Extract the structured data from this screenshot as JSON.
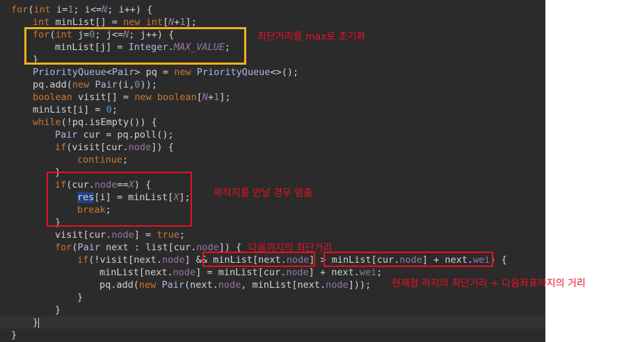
{
  "editor": {
    "lines": [
      "for(int i=1; i<=N; i++) {",
      "int minList[] = new int[N+1];",
      "for(int j=0; j<=N; j++) {",
      "minList[j] = Integer.MAX_VALUE;",
      "}",
      "PriorityQueue<Pair> pq = new PriorityQueue<>();",
      "pq.add(new Pair(i,0));",
      "boolean visit[] = new boolean[N+1];",
      "minList[i] = 0;",
      "while(!pq.isEmpty()) {",
      "Pair cur = pq.poll();",
      "if(visit[cur.node]) {",
      "continue;",
      "}",
      "if(cur.node==X) {",
      "res[i] = minList[X];",
      "break;",
      "}",
      "visit[cur.node] = true;",
      "for(Pair next : list[cur.node]) {",
      "if(!visit[next.node] && minList[next.node] > minList[cur.node] + next.wei) {",
      "minList[next.node] = minList[cur.node] + next.wei;",
      "pq.add(new Pair(next.node, minList[next.node]));",
      "}",
      "}",
      "}",
      "}"
    ]
  },
  "annotations": {
    "init_note": "최단거리를 max로 초기화",
    "stop_note": "목적지를 만날 경우 멈춤",
    "next_note": "다음까지의 최단거리",
    "current_note": "현재점 까지의 최단거리 + 다음좌표까지의 거리"
  },
  "colors": {
    "editor_bg": "#2b2b2b",
    "keyword": "#cc7832",
    "annotation_red": "#e81123",
    "annotation_yellow": "#f2b21b"
  }
}
